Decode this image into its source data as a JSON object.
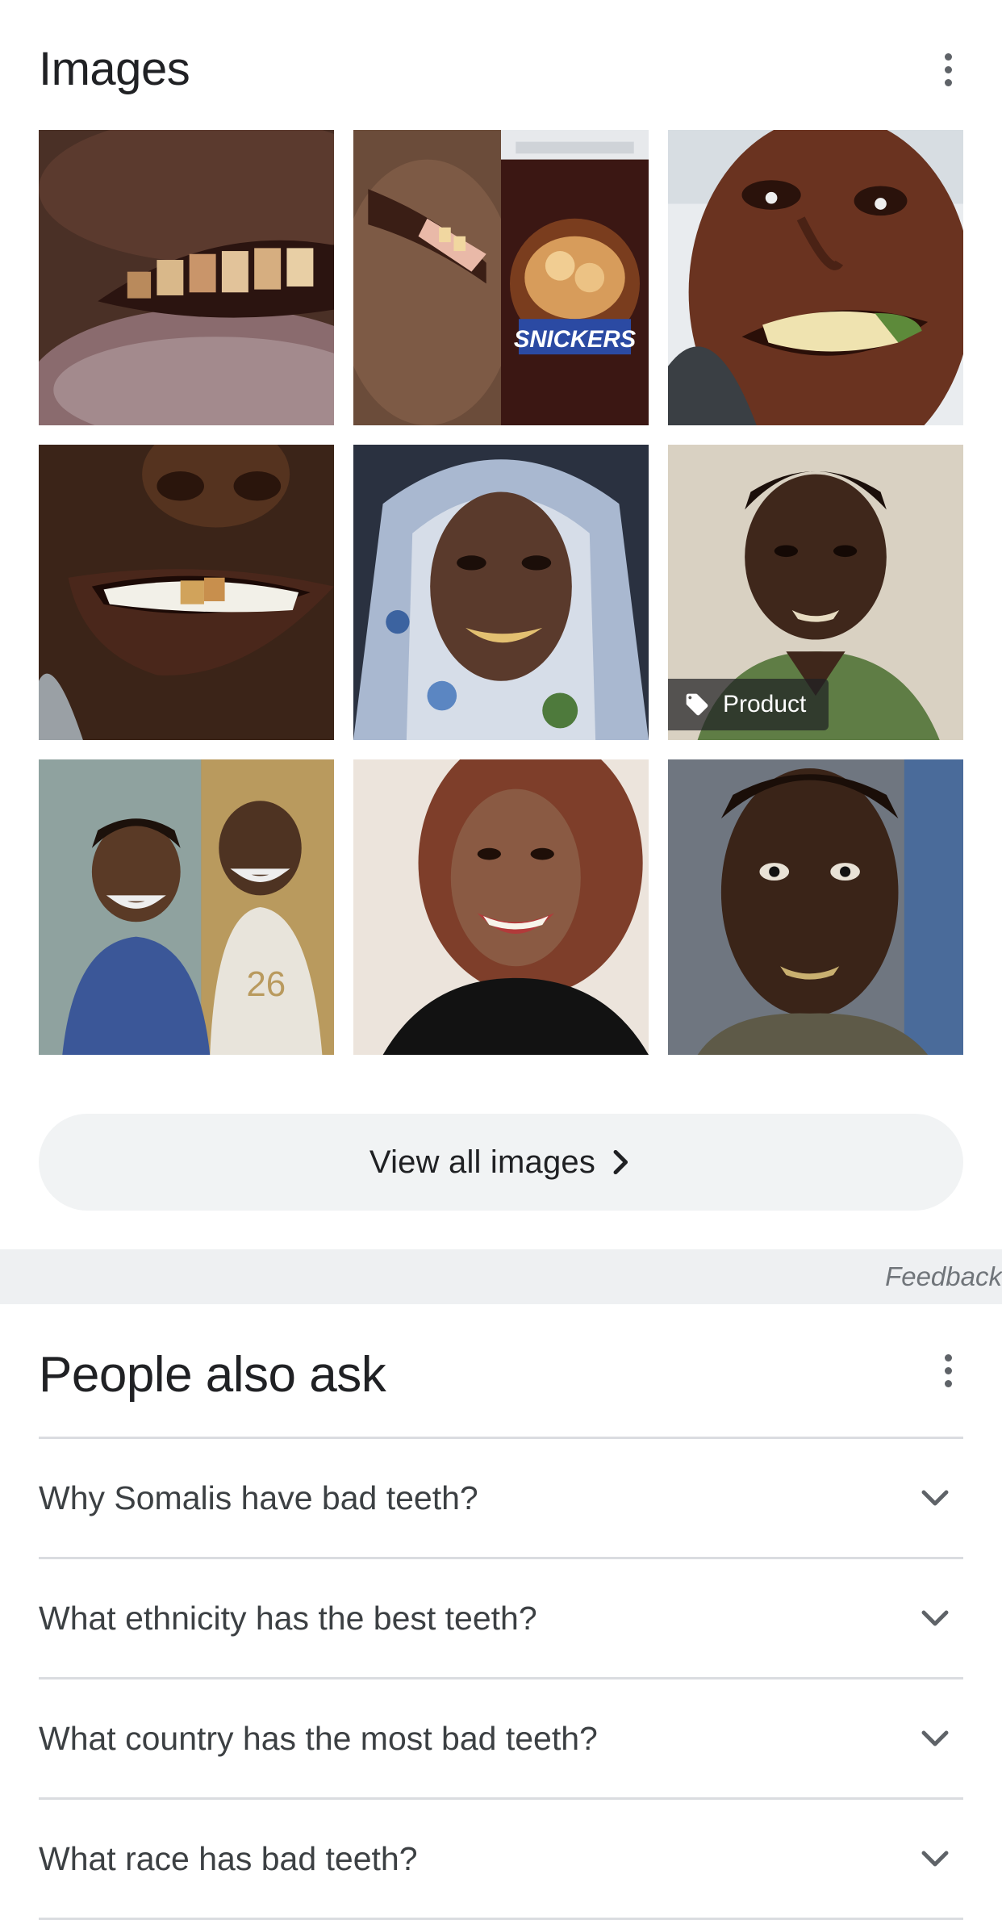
{
  "images_section": {
    "title": "Images",
    "tiles": [
      {
        "alt": "",
        "badge": ""
      },
      {
        "alt": "",
        "badge": ""
      },
      {
        "alt": "",
        "badge": ""
      },
      {
        "alt": "",
        "badge": ""
      },
      {
        "alt": "",
        "badge": ""
      },
      {
        "alt": "",
        "badge": "Product"
      },
      {
        "alt": "",
        "badge": ""
      },
      {
        "alt": "",
        "badge": ""
      },
      {
        "alt": "",
        "badge": ""
      }
    ],
    "snickers_text": "SNICKERS",
    "shirt_number": "26",
    "view_all_label": "View all images"
  },
  "feedback_label": "Feedback",
  "people_also_ask": {
    "title": "People also ask",
    "questions": [
      "Why Somalis have bad teeth?",
      "What ethnicity has the best teeth?",
      "What country has the most bad teeth?",
      "What race has bad teeth?"
    ]
  },
  "icons": {
    "more": "more-vert-icon",
    "chevron_right": "chevron-right-icon",
    "chevron_down": "chevron-down-icon",
    "tag": "tag-icon"
  }
}
